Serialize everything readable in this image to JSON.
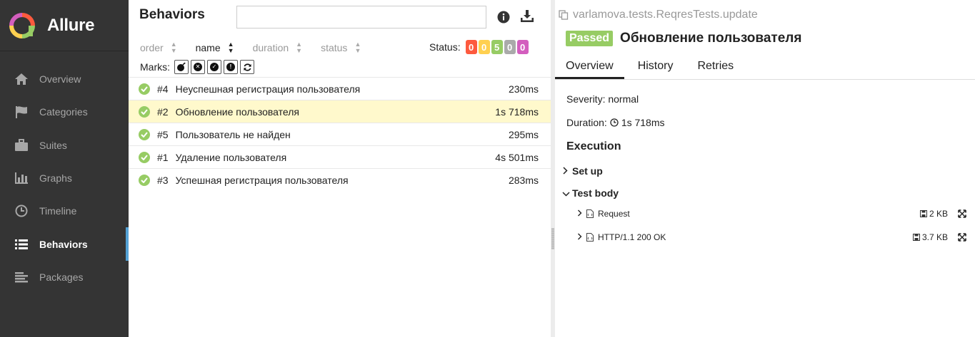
{
  "brand": {
    "name": "Allure"
  },
  "sidebar": {
    "items": [
      {
        "label": "Overview",
        "icon": "home-icon"
      },
      {
        "label": "Categories",
        "icon": "flag-icon"
      },
      {
        "label": "Suites",
        "icon": "briefcase-icon"
      },
      {
        "label": "Graphs",
        "icon": "bar-chart-icon"
      },
      {
        "label": "Timeline",
        "icon": "clock-icon"
      },
      {
        "label": "Behaviors",
        "icon": "list-icon",
        "active": true
      },
      {
        "label": "Packages",
        "icon": "align-left-icon"
      }
    ]
  },
  "middle": {
    "title": "Behaviors",
    "search": {
      "value": "",
      "placeholder": ""
    },
    "sort": [
      {
        "label": "order"
      },
      {
        "label": "name",
        "active": true
      },
      {
        "label": "duration"
      },
      {
        "label": "status"
      }
    ],
    "status": {
      "label": "Status:",
      "counts": [
        {
          "value": "0",
          "color": "#fd5a3e"
        },
        {
          "value": "0",
          "color": "#ffd050"
        },
        {
          "value": "5",
          "color": "#97cc64"
        },
        {
          "value": "0",
          "color": "#aaaaaa"
        },
        {
          "value": "0",
          "color": "#d35ebe"
        }
      ]
    },
    "marks": {
      "label": "Marks:",
      "icons": [
        "bomb-icon",
        "times-circle-icon",
        "check-circle-icon",
        "exclamation-circle-icon",
        "refresh-icon"
      ]
    },
    "rows": [
      {
        "num": "#4",
        "name": "Неуспешная регистрация пользователя",
        "duration": "230ms"
      },
      {
        "num": "#2",
        "name": "Обновление пользователя",
        "duration": "1s 718ms",
        "selected": true
      },
      {
        "num": "#5",
        "name": "Пользователь не найден",
        "duration": "295ms"
      },
      {
        "num": "#1",
        "name": "Удаление пользователя",
        "duration": "4s 501ms"
      },
      {
        "num": "#3",
        "name": "Успешная регистрация пользователя",
        "duration": "283ms"
      }
    ]
  },
  "right": {
    "fullname": "varlamova.tests.ReqresTests.update",
    "status_badge": "Passed",
    "title": "Обновление пользователя",
    "tabs": [
      "Overview",
      "History",
      "Retries"
    ],
    "severity": "Severity: normal",
    "duration_label": "Duration:",
    "duration_value": "1s 718ms",
    "execution_title": "Execution",
    "steps": {
      "setup": "Set up",
      "test_body": "Test body"
    },
    "attachments": [
      {
        "name": "Request",
        "size": "2 KB"
      },
      {
        "name": "HTTP/1.1 200 OK",
        "size": "3.7 KB"
      }
    ]
  },
  "colors": {
    "sidebar_bg": "#343434",
    "accent": "#54a2d6",
    "passed": "#97cc64",
    "selected_row": "#fff9cc"
  }
}
